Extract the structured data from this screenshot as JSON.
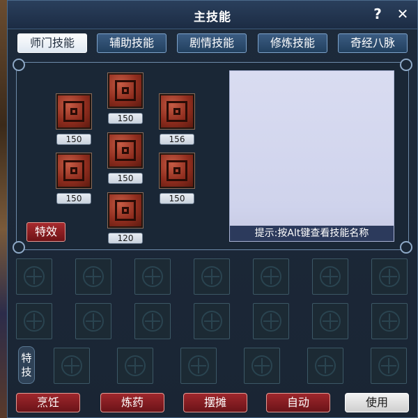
{
  "window": {
    "title": "主技能",
    "help_label": "?",
    "close_label": "✕"
  },
  "tabs": [
    {
      "label": "师门技能",
      "active": true
    },
    {
      "label": "辅助技能",
      "active": false
    },
    {
      "label": "剧情技能",
      "active": false
    },
    {
      "label": "修炼技能",
      "active": false
    },
    {
      "label": "奇经八脉",
      "active": false
    }
  ],
  "skills": [
    {
      "level": "150"
    },
    {
      "level": "150"
    },
    {
      "level": "156"
    },
    {
      "level": "150"
    },
    {
      "level": "150"
    },
    {
      "level": "150"
    },
    {
      "level": "120"
    }
  ],
  "effect_button": "特效",
  "info_panel": {
    "hint": "提示:按Alt键查看技能名称"
  },
  "special_skills_label": "特技",
  "bottom_buttons": [
    {
      "label": "烹饪"
    },
    {
      "label": "炼药"
    },
    {
      "label": "摆摊"
    },
    {
      "label": "自动"
    },
    {
      "label": "使用"
    }
  ],
  "colors": {
    "window_bg": "#1d2a3b",
    "tab_active_bg": "#ffffff",
    "red_button": "#9f272c",
    "skill_icon": "#a43b2b",
    "info_box": "#d2d6ee"
  },
  "icons": {
    "help": "question-icon",
    "close": "close-icon",
    "skill_slot": "empty-slot-icon"
  }
}
